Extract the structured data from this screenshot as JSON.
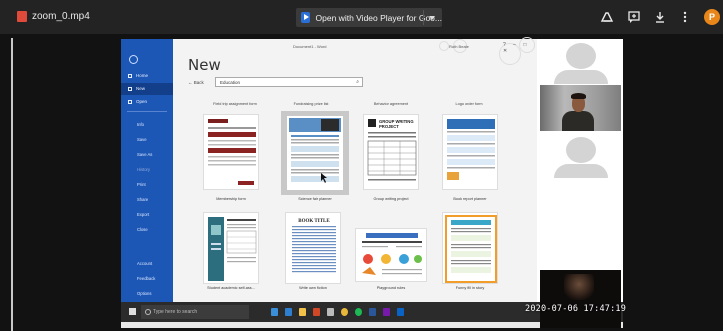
{
  "player": {
    "file_name": "zoom_0.mp4",
    "open_with_label": "Open with Video Player for Goo...",
    "icons": [
      "video-file-icon",
      "video-player-app-icon",
      "chevron-down-icon",
      "drive-add-icon",
      "add-comment-icon",
      "download-icon",
      "more-vert-icon"
    ],
    "avatar_initial": "P",
    "accent": "#e8861a"
  },
  "word": {
    "window_title": "Document1 - Word",
    "user_name": "Ruth Beale",
    "window_controls": "?  –  □  ✕",
    "heading": "New",
    "back_label": "Back",
    "search_value": "Education",
    "sidebar": {
      "nav": [
        {
          "label": "Home",
          "icon": "home-icon"
        },
        {
          "label": "New",
          "icon": "new-doc-icon",
          "active": true
        },
        {
          "label": "Open",
          "icon": "open-folder-icon"
        }
      ],
      "sub": [
        "Info",
        "Save",
        "Save As",
        "History",
        "Print",
        "Share",
        "Export",
        "Close"
      ],
      "muted": [
        "History"
      ],
      "bottom": [
        "Account",
        "Feedback",
        "Options"
      ]
    },
    "top_row_captions": [
      "Field trip assignment form",
      "Fundraising prize list",
      "Behavior agreement",
      "Logo order form"
    ],
    "templates_row1": [
      {
        "caption": "Membership form",
        "selected": false
      },
      {
        "caption": "Science fair planner",
        "selected": true
      },
      {
        "caption": "Group writing project",
        "selected": false,
        "title": "GROUP WRITING PROJECT"
      },
      {
        "caption": "Book report planner",
        "selected": false
      }
    ],
    "templates_row2": [
      {
        "caption": "Student academic self-ass...",
        "selected": false
      },
      {
        "caption": "Write own fiction",
        "selected": false,
        "title": "BOOK TITLE"
      },
      {
        "caption": "Playground rules",
        "selected": false
      },
      {
        "caption": "Funny fill in story",
        "selected": false
      }
    ],
    "brand_color": "#1d57b6"
  },
  "taskbar": {
    "search_placeholder": "Type here to search",
    "apps": [
      "task-view-icon",
      "edge-icon",
      "file-explorer-icon",
      "office-icon",
      "store-icon",
      "chrome-icon",
      "spotify-icon",
      "word-icon",
      "onenote-icon",
      "mail-icon"
    ]
  },
  "participants": {
    "timestamp": "2020-07-06  17:47:19"
  }
}
